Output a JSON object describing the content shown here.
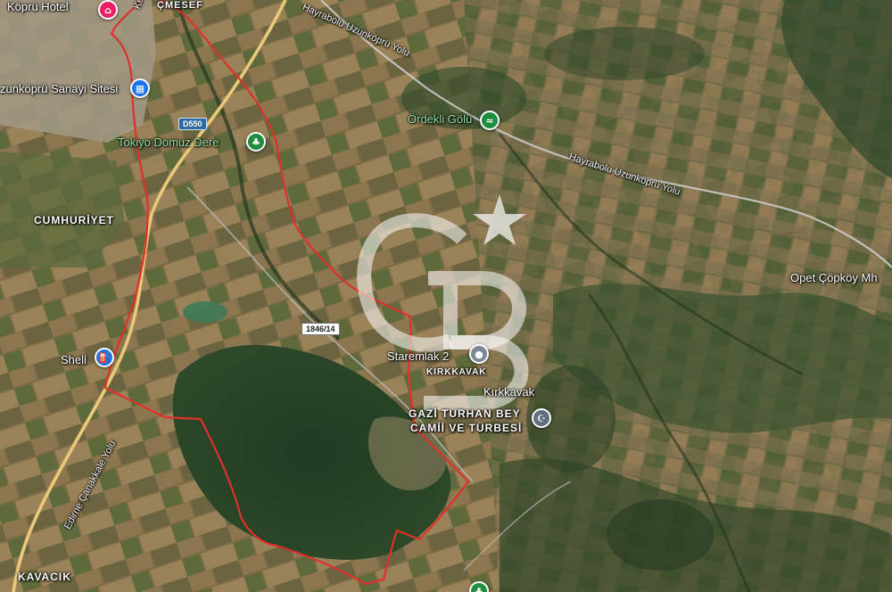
{
  "map": {
    "type": "satellite",
    "colors": {
      "boundary": "#e0302b",
      "watermark": "#ffffff",
      "pin_blue": "#1a73e8",
      "pin_green": "#1e8e3e",
      "pin_pink": "#e91e63",
      "pin_gray": "#7b8794",
      "pin_slate": "#5f6f80"
    },
    "labels": {
      "kopru_hotel": "Köprü Hotel",
      "kesan_cad": "Keşan Cad.",
      "cmesef": "ÇMESEF",
      "hayrabolu_road_1": "Hayrabolu Uzunköprü Yolu",
      "hayrabolu_road_2": "Hayrabolu Uzunköprü Yolu",
      "sanayi": "zunköprü Sanayi Sitesi",
      "ordekli": "Ördekli Gölü",
      "tokiyo": "Tokiyo Domuz Dere",
      "cumhuriyet": "CUMHURİYET",
      "opet": "Opet Çöpköy Mh",
      "shell": "Shell",
      "staremlak": "Staremlak 2",
      "kirkkavak_caps": "KIRKKAVAK",
      "kirkkavak": "Kırkkavak",
      "gazi_line1": "GAZİ TURHAN BEY",
      "gazi_line2": "CAMİİ VE TÜRBESİ",
      "edirne_road": "Edirne Çanakkale Yolu",
      "kavacik": "KAVACIK"
    },
    "road_shields": {
      "d550": "D550",
      "r1846": "1846/14"
    },
    "icons": {
      "hotel": "bed-icon",
      "industrial": "factory-icon",
      "lake": "lake-icon",
      "park": "tree-icon",
      "gas_station": "gas-station-icon",
      "place": "location-pin-icon",
      "mosque": "mosque-icon",
      "star": "star-icon",
      "watermark": "logo-watermark"
    }
  }
}
